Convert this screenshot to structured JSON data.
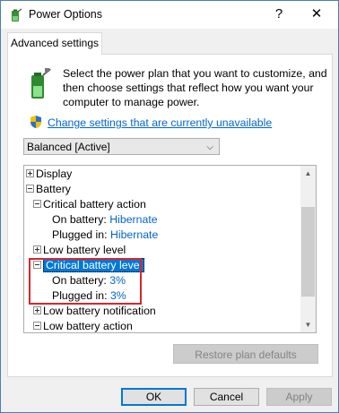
{
  "window": {
    "title": "Power Options",
    "help_glyph": "?",
    "close_glyph": "✕",
    "icon": "power-options-icon"
  },
  "tab": {
    "label": "Advanced settings"
  },
  "description": "Select the power plan that you want to customize, and then choose settings that reflect how you want your computer to manage power.",
  "change_link": {
    "label": "Change settings that are currently unavailable",
    "icon": "uac-shield-icon"
  },
  "plan_dropdown": {
    "selected": "Balanced [Active]"
  },
  "tree": {
    "display": "Display",
    "battery": "Battery",
    "critical_battery_action": "Critical battery action",
    "cba_on_battery_label": "On battery:",
    "cba_on_battery_value": "Hibernate",
    "cba_plugged_in_label": "Plugged in:",
    "cba_plugged_in_value": "Hibernate",
    "low_battery_level": "Low battery level",
    "critical_battery_level": "Critical battery level",
    "cbl_on_battery_label": "On battery:",
    "cbl_on_battery_value": "3%",
    "cbl_plugged_in_label": "Plugged in:",
    "cbl_plugged_in_value": "3%",
    "low_battery_notification": "Low battery notification",
    "low_battery_action": "Low battery action"
  },
  "buttons": {
    "restore": "Restore plan defaults",
    "ok": "OK",
    "cancel": "Cancel",
    "apply": "Apply"
  },
  "colors": {
    "link": "#0066cc",
    "selection": "#0078d7",
    "highlight_box": "#d9252b"
  }
}
